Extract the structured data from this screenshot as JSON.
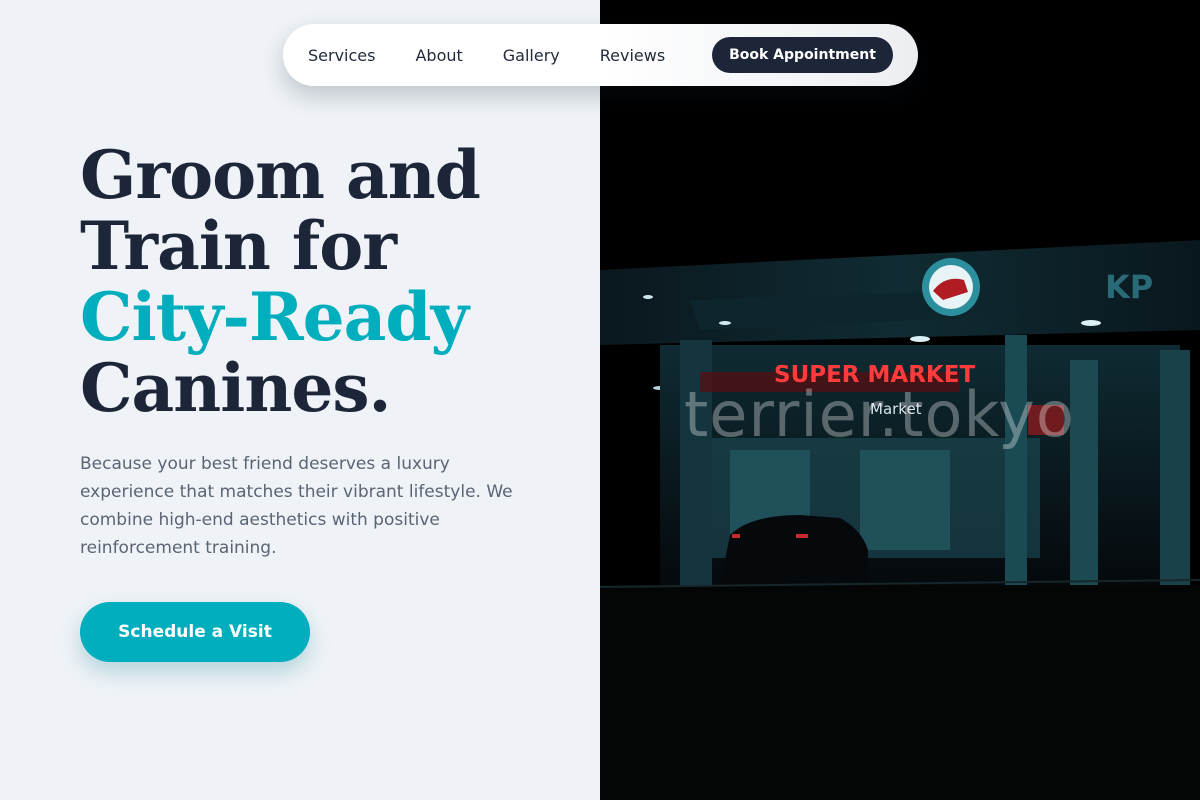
{
  "nav": {
    "links": [
      "Services",
      "About",
      "Gallery",
      "Reviews"
    ],
    "book_label": "Book Appointment"
  },
  "hero": {
    "line1": "Groom and",
    "line2": "Train for",
    "accent": "City-Ready",
    "line4": "Canines.",
    "subtext": "Because your best friend deserves a luxury experience that matches their vibrant lifestyle. We combine high-end aesthetics with positive reinforcement training.",
    "cta_label": "Schedule a Visit"
  },
  "photo": {
    "store_sign": "SUPER MARKET",
    "store_sub": "Market",
    "corner_sign": "KP",
    "watermark": "terrier.tokyo"
  },
  "colors": {
    "accent": "#00aebd",
    "dark": "#1d2639",
    "background": "#eff3f7"
  }
}
